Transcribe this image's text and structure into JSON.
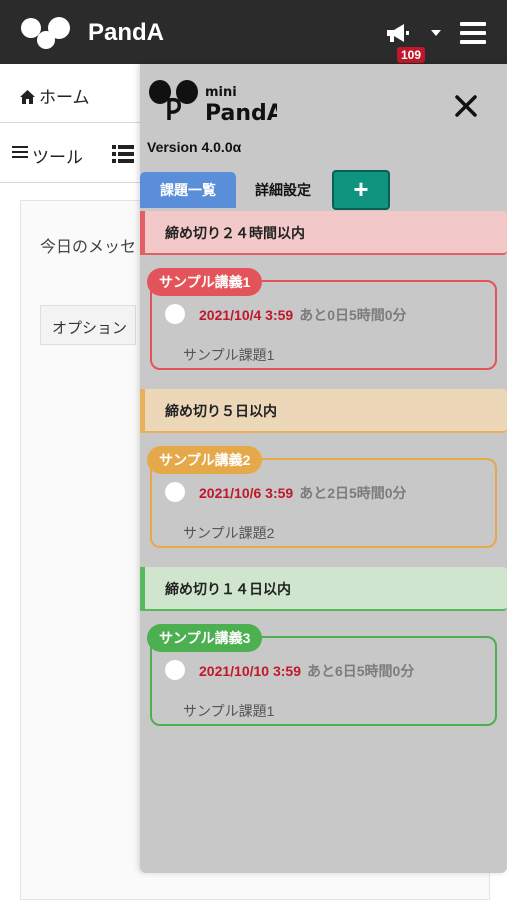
{
  "header": {
    "logo_text": "PandA",
    "notification_count": "109"
  },
  "background": {
    "home_label": "ホーム",
    "tools_label": "ツール",
    "message_label": "今日のメッセ",
    "option_label": "オプション"
  },
  "minipanda": {
    "logo_small": "mini",
    "logo_large": "PandA",
    "version": "Version 4.0.0α",
    "tabs": {
      "list": "課題一覧",
      "settings": "詳細設定",
      "add": "+"
    },
    "sections": [
      {
        "title": "締め切り２４時間以内",
        "color": "#e2545a",
        "card": {
          "lecture": "サンプル講義1",
          "due_date": "2021/10/4 3:59",
          "remaining": "あと0日5時間0分",
          "assignment": "サンプル課題1"
        }
      },
      {
        "title": "締め切り５日以内",
        "color": "#e5a94a",
        "card": {
          "lecture": "サンプル講義2",
          "due_date": "2021/10/6 3:59",
          "remaining": "あと2日5時間0分",
          "assignment": "サンプル課題2"
        }
      },
      {
        "title": "締め切り１４日以内",
        "color": "#4caf50",
        "card": {
          "lecture": "サンプル講義3",
          "due_date": "2021/10/10 3:59",
          "remaining": "あと6日5時間0分",
          "assignment": "サンプル課題1"
        }
      }
    ]
  }
}
